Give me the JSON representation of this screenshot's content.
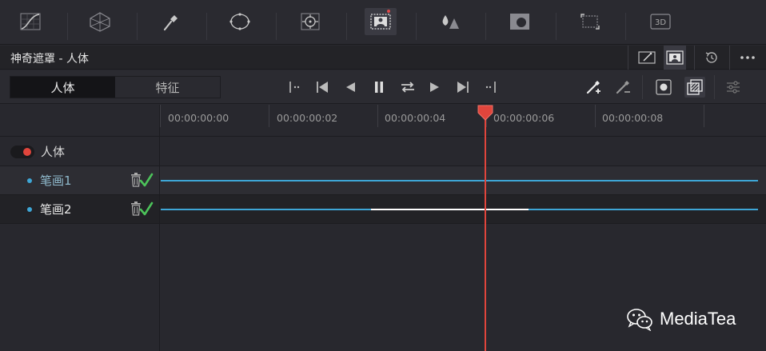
{
  "toolbar": {
    "tools": [
      {
        "name": "curves-icon"
      },
      {
        "name": "warper-icon"
      },
      {
        "name": "qualifier-icon"
      },
      {
        "name": "window-icon"
      },
      {
        "name": "tracker-icon"
      },
      {
        "name": "magic-mask-icon"
      },
      {
        "name": "blur-icon"
      },
      {
        "name": "key-icon"
      },
      {
        "name": "sizing-icon"
      },
      {
        "name": "3d-icon",
        "label": "3D"
      }
    ]
  },
  "titlebar": {
    "title": "神奇遮罩 - 人体"
  },
  "controls": {
    "segments": [
      "人体",
      "特征"
    ]
  },
  "timeline": {
    "timecodes": [
      "00:00:00:00",
      "00:00:00:02",
      "00:00:00:04",
      "00:00:00:06",
      "00:00:00:08"
    ]
  },
  "layers": {
    "group_label": "人体",
    "strokes": [
      {
        "label": "笔画1"
      },
      {
        "label": "笔画2"
      }
    ]
  },
  "watermark": {
    "text": "MediaTea"
  },
  "colors": {
    "accent_red": "#e0453c",
    "track_blue": "#3ea6d6",
    "check_green": "#4cc25a",
    "background": "#28282e"
  }
}
